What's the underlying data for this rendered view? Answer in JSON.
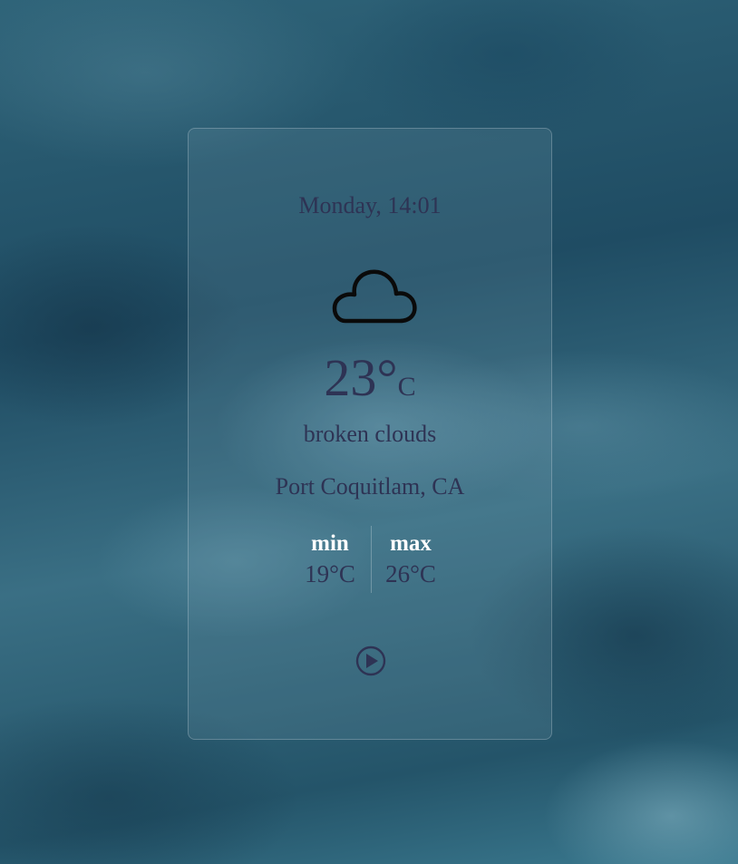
{
  "weather": {
    "datetime": "Monday, 14:01",
    "condition_icon": "cloud-icon",
    "temperature": "23°",
    "temperature_unit": "C",
    "description": "broken clouds",
    "location": "Port Coquitlam, CA",
    "min_label": "min",
    "min_value": "19°C",
    "max_label": "max",
    "max_value": "26°C",
    "action_icon": "play-icon"
  },
  "colors": {
    "text": "#2e3354",
    "label": "#ffffff",
    "background": "#2a5a70"
  }
}
